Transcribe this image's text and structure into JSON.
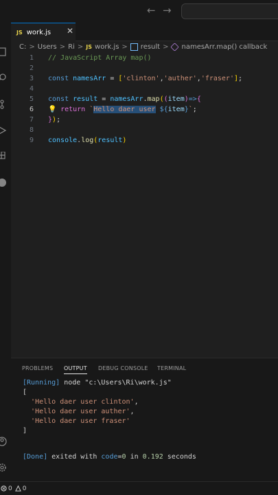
{
  "titlebar": {
    "back_arrow": "←",
    "forward_arrow": "→",
    "search_placeholder": ""
  },
  "tab": {
    "icon_text": "JS",
    "label": "work.js",
    "close": "✕"
  },
  "breadcrumb": [
    "C:",
    "Users",
    "Ri",
    "work.js",
    "result",
    "namesArr.map() callback"
  ],
  "breadcrumb_js": "JS",
  "editor": {
    "lines": [
      {
        "n": "1",
        "tokens": [
          [
            "c-comment",
            "// JavaScript Array map()"
          ]
        ]
      },
      {
        "n": "2",
        "tokens": []
      },
      {
        "n": "3",
        "tokens": [
          [
            "c-kw",
            "const "
          ],
          [
            "c-var",
            "namesArr"
          ],
          [
            "c-plain",
            " = "
          ],
          [
            "c-brace1",
            "["
          ],
          [
            "c-str",
            "'clinton'"
          ],
          [
            "c-plain",
            ","
          ],
          [
            "c-str",
            "'auther'"
          ],
          [
            "c-plain",
            ","
          ],
          [
            "c-str",
            "'fraser'"
          ],
          [
            "c-brace1",
            "]"
          ],
          [
            "c-plain",
            ";"
          ]
        ]
      },
      {
        "n": "4",
        "tokens": []
      },
      {
        "n": "5",
        "tokens": [
          [
            "c-kw",
            "const "
          ],
          [
            "c-var",
            "result"
          ],
          [
            "c-plain",
            " = "
          ],
          [
            "c-var",
            "namesArr"
          ],
          [
            "c-plain",
            "."
          ],
          [
            "c-fn",
            "map"
          ],
          [
            "c-brace1",
            "("
          ],
          [
            "c-brace2",
            "("
          ],
          [
            "c-param",
            "item"
          ],
          [
            "c-brace2",
            ")"
          ],
          [
            "c-kw",
            "=>"
          ],
          [
            "c-brace2",
            "{"
          ]
        ]
      },
      {
        "n": "6",
        "active": true,
        "tokens": [
          [
            "c-plain",
            "   "
          ],
          [
            "c-brace2",
            "return "
          ],
          [
            "c-str",
            "`"
          ],
          [
            "sel c-str",
            "Hello daer user"
          ],
          [
            "c-str",
            " "
          ],
          [
            "c-tpl",
            "${"
          ],
          [
            "c-param",
            "item"
          ],
          [
            "c-tpl",
            "}"
          ],
          [
            "c-str",
            "`"
          ],
          [
            "c-plain",
            ";"
          ]
        ]
      },
      {
        "n": "7",
        "tokens": [
          [
            "c-brace2",
            "}"
          ],
          [
            "c-brace1",
            ")"
          ],
          [
            "c-plain",
            ";"
          ]
        ]
      },
      {
        "n": "8",
        "tokens": []
      },
      {
        "n": "9",
        "tokens": [
          [
            "c-var",
            "console"
          ],
          [
            "c-plain",
            "."
          ],
          [
            "c-fn",
            "log"
          ],
          [
            "c-brace1",
            "("
          ],
          [
            "c-var",
            "result"
          ],
          [
            "c-brace1",
            ")"
          ]
        ]
      }
    ]
  },
  "panel": {
    "tabs": [
      "PROBLEMS",
      "OUTPUT",
      "DEBUG CONSOLE",
      "TERMINAL"
    ],
    "active_tab": "OUTPUT",
    "output": [
      [
        [
          "o-run",
          "[Running] "
        ],
        [
          "o-plain",
          "node \"c:\\Users\\Ri\\work.js\""
        ]
      ],
      [
        [
          "o-plain",
          "["
        ]
      ],
      [
        [
          "o-plain",
          "  "
        ],
        [
          "o-str",
          "'Hello daer user clinton'"
        ],
        [
          "o-plain",
          ","
        ]
      ],
      [
        [
          "o-plain",
          "  "
        ],
        [
          "o-str",
          "'Hello daer user auther'"
        ],
        [
          "o-plain",
          ","
        ]
      ],
      [
        [
          "o-plain",
          "  "
        ],
        [
          "o-str",
          "'Hello daer user fraser'"
        ]
      ],
      [
        [
          "o-plain",
          "]"
        ]
      ],
      [],
      [
        [
          "o-run",
          "[Done] "
        ],
        [
          "o-plain",
          "exited with "
        ],
        [
          "o-run",
          "code"
        ],
        [
          "o-plain",
          "="
        ],
        [
          "o-num",
          "0"
        ],
        [
          "o-plain",
          " in "
        ],
        [
          "o-num",
          "0.192"
        ],
        [
          "o-plain",
          " seconds"
        ]
      ]
    ]
  },
  "status": {
    "errors": "0",
    "warnings": "0"
  },
  "colors": {
    "accent": "#0078d4",
    "editor_bg": "#1f1f1f",
    "chrome_bg": "#181818"
  }
}
